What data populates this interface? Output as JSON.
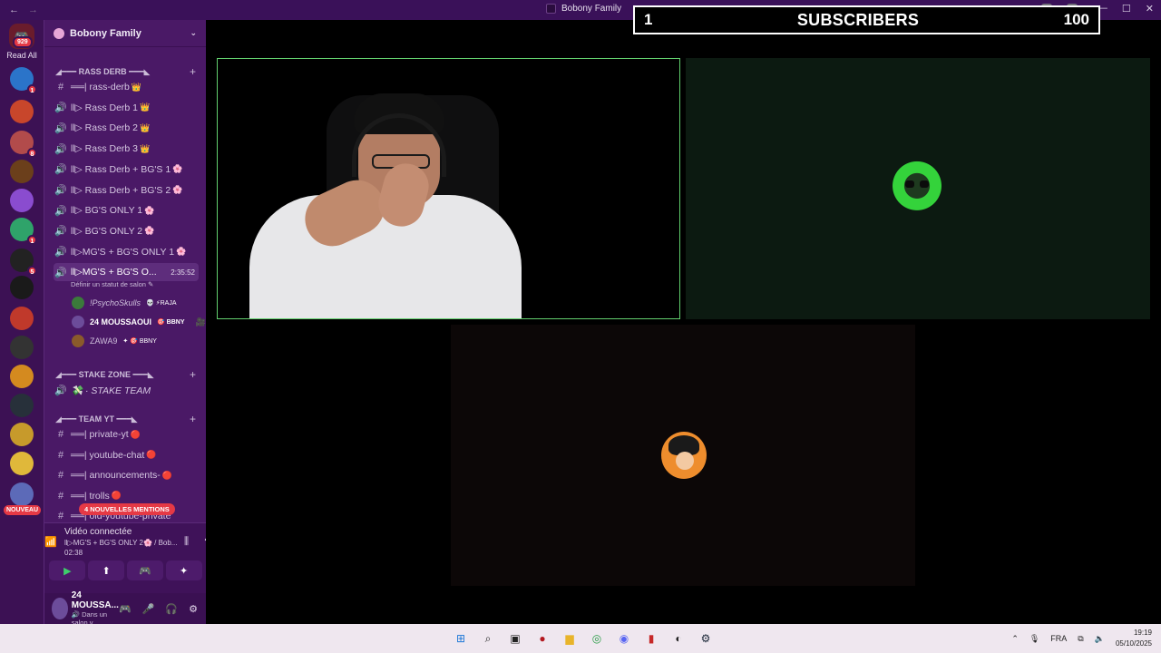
{
  "titlebar": {
    "back_arrow": "←",
    "forward_arrow": "→",
    "title": "Bobony Family",
    "minimize": "—",
    "maximize": "☐",
    "close": "✕"
  },
  "subscriber_bar": {
    "left": "1",
    "label": "SUBSCRIBERS",
    "right": "100"
  },
  "rail": {
    "home_badge": "929",
    "read_all": "Read All",
    "servers": [
      {
        "name": "EA",
        "color": "#2b74c9",
        "badge": "1"
      },
      {
        "name": "server-2",
        "color": "#c8462b",
        "badge": ""
      },
      {
        "name": "server-3",
        "color": "#b24b4b",
        "badge": "8"
      },
      {
        "name": "server-4",
        "color": "#6b3f1b",
        "badge": ""
      },
      {
        "name": "server-5",
        "color": "#8a4ccf",
        "badge": ""
      },
      {
        "name": "server-6",
        "color": "#2fa36a",
        "badge": "1"
      },
      {
        "name": "server-7",
        "color": "#222222",
        "badge": "5"
      },
      {
        "name": "server-8",
        "color": "#1a1a1a",
        "badge": ""
      },
      {
        "name": "server-9",
        "color": "#c0392b",
        "badge": ""
      },
      {
        "name": "server-10",
        "color": "#333333",
        "badge": ""
      },
      {
        "name": "server-11",
        "color": "#d48a1f",
        "badge": ""
      },
      {
        "name": "server-12",
        "color": "#27303a",
        "badge": ""
      },
      {
        "name": "server-13",
        "color": "#c79a2b",
        "badge": ""
      },
      {
        "name": "server-14",
        "color": "#e0b83a",
        "badge": ""
      },
      {
        "name": "server-15",
        "color": "#5c6ab8",
        "badge": ""
      }
    ],
    "nouveau": "NOUVEAU"
  },
  "sidebar": {
    "server_name": "Bobony Family",
    "categories": {
      "rass_derb": "◢━━━ RASS DERB ━━━◣",
      "stake_zone": "◢━━━ STAKE ZONE ━━━◣",
      "team_yt": "◢━━━ TEAM YT ━━━◣"
    },
    "channels": [
      {
        "icon": "#",
        "label": "══| rass-derb",
        "emoji": "👑"
      },
      {
        "icon": "🔊",
        "label": "ll▷ Rass Derb 1",
        "emoji": "👑"
      },
      {
        "icon": "🔊",
        "label": "ll▷ Rass Derb 2",
        "emoji": "👑"
      },
      {
        "icon": "🔊",
        "label": "ll▷ Rass Derb 3",
        "emoji": "👑"
      },
      {
        "icon": "🔊",
        "label": "ll▷ Rass Derb + BG'S 1",
        "emoji": "🌸"
      },
      {
        "icon": "🔊",
        "label": "ll▷ Rass Derb + BG'S 2",
        "emoji": "🌸"
      },
      {
        "icon": "🔊",
        "label": "ll▷ BG'S ONLY 1",
        "emoji": "🌸"
      },
      {
        "icon": "🔊",
        "label": "ll▷ BG'S ONLY 2",
        "emoji": "🌸"
      },
      {
        "icon": "🔊",
        "label": "ll▷MG'S + BG'S ONLY 1",
        "emoji": "🌸"
      }
    ],
    "active_channel": {
      "icon": "🔊",
      "label": "ll▷MG'S + BG'S O...",
      "time": "2:35:52",
      "status": "Définir un statut de salon ✎"
    },
    "voice_users": [
      {
        "name": "!PsychoSkulls",
        "tag": "💀 ⚡RAJA",
        "color": "#3b7a3b"
      },
      {
        "name": "24 MOUSSAOUI",
        "tag": "🎯 BBNY",
        "color": "#6c4c9a",
        "cam": "🎥"
      },
      {
        "name": "ZAWA9",
        "tag": "✦ 🎯 BBNY",
        "color": "#8a5a2b"
      }
    ],
    "stake_channel": {
      "icon": "🔊",
      "label": "💸 · STAKE TEAM"
    },
    "yt_channels": [
      {
        "icon": "#",
        "label": "══| private-yt",
        "emoji": "🔴"
      },
      {
        "icon": "#",
        "label": "══| youtube-chat",
        "emoji": "🔴"
      },
      {
        "icon": "#",
        "label": "══| announcements-",
        "emoji": "🔴"
      },
      {
        "icon": "#",
        "label": "══| trolls",
        "emoji": "🔴"
      },
      {
        "icon": "#",
        "label": "══| old-youtube-private",
        "emoji": ""
      }
    ],
    "mentions_badge": "4 NOUVELLES MENTIONS"
  },
  "voice_panel": {
    "title": "Vidéo connectée",
    "channel": "ll▷MG'S + BG'S ONLY 2🌸 / Bob...",
    "time": "02:38",
    "buttons": [
      "camera",
      "screen-share",
      "activity",
      "soundboard"
    ]
  },
  "user_panel": {
    "name": "24 MOUSSA...",
    "status": "🔊 Dans un salon v..."
  },
  "taskbar": {
    "lang": "FRA",
    "time": "19:19",
    "date": "05/10/2025"
  }
}
